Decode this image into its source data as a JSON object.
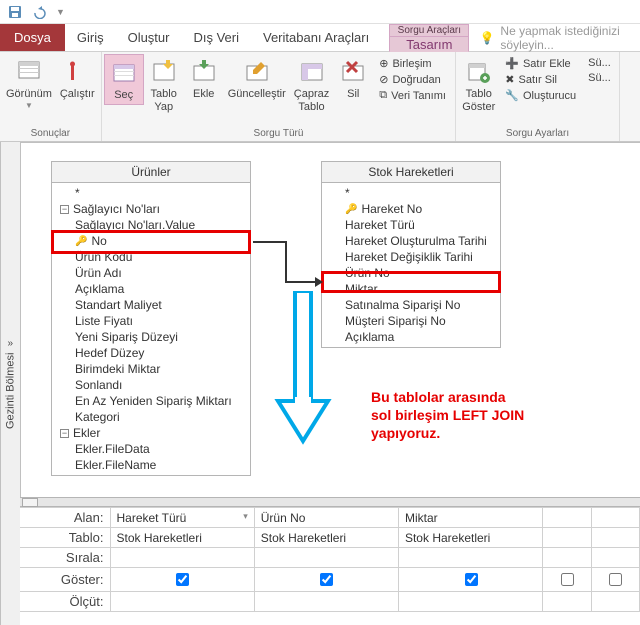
{
  "qat": {
    "save": "save",
    "undo": "undo",
    "redo": "redo"
  },
  "tabs": {
    "file": "Dosya",
    "home": "Giriş",
    "create": "Oluştur",
    "external": "Dış Veri",
    "dbtools": "Veritabanı Araçları",
    "context_group": "Sorgu Araçları",
    "design": "Tasarım"
  },
  "tellme": "Ne yapmak istediğinizi söyleyin...",
  "ribbon": {
    "results": {
      "view": "Görünüm",
      "run": "Çalıştır",
      "label": "Sonuçlar"
    },
    "querytype": {
      "select": "Seç",
      "maketable": "Tablo\nYap",
      "append": "Ekle",
      "update": "Güncelleştir",
      "crosstab": "Çapraz\nTablo",
      "delete": "Sil",
      "union": "Birleşim",
      "passthrough": "Doğrudan",
      "datadef": "Veri Tanımı",
      "label": "Sorgu Türü"
    },
    "querysetup": {
      "showtable": "Tablo\nGöster",
      "insertrow": "Satır Ekle",
      "deleterow": "Satır Sil",
      "builder": "Oluşturucu",
      "insertcol": "Sü...",
      "deletecol": "Sü...",
      "label": "Sorgu Ayarları"
    }
  },
  "navpane": "Gezinti Bölmesi",
  "tables": {
    "urunler": {
      "title": "Ürünler",
      "fields": [
        "*",
        "Sağlayıcı No'ları",
        "Sağlayıcı No'ları.Value",
        "No",
        "Ürün Kodu",
        "Ürün Adı",
        "Açıklama",
        "Standart Maliyet",
        "Liste Fiyatı",
        "Yeni Sipariş Düzeyi",
        "Hedef Düzey",
        "Birimdeki Miktar",
        "Sonlandı",
        "En Az Yeniden Sipariş Miktarı",
        "Kategori",
        "Ekler",
        "Ekler.FileData",
        "Ekler.FileName"
      ]
    },
    "stok": {
      "title": "Stok Hareketleri",
      "fields": [
        "*",
        "Hareket No",
        "Hareket Türü",
        "Hareket Oluşturulma Tarihi",
        "Hareket Değişiklik Tarihi",
        "Ürün No",
        "Miktar",
        "Satınalma Siparişi No",
        "Müşteri Siparişi No",
        "Açıklama"
      ]
    }
  },
  "annotation": "Bu tablolar arasında\nsol birleşim LEFT JOIN\nyapıyoruz.",
  "qbe": {
    "labels": {
      "field": "Alan:",
      "table": "Tablo:",
      "sort": "Sırala:",
      "show": "Göster:",
      "criteria": "Ölçüt:"
    },
    "cols": [
      {
        "field": "Hareket Türü",
        "table": "Stok Hareketleri",
        "show": true
      },
      {
        "field": "Ürün No",
        "table": "Stok Hareketleri",
        "show": true
      },
      {
        "field": "Miktar",
        "table": "Stok Hareketleri",
        "show": true
      },
      {
        "field": "",
        "table": "",
        "show": false
      },
      {
        "field": "",
        "table": "",
        "show": false
      }
    ]
  }
}
